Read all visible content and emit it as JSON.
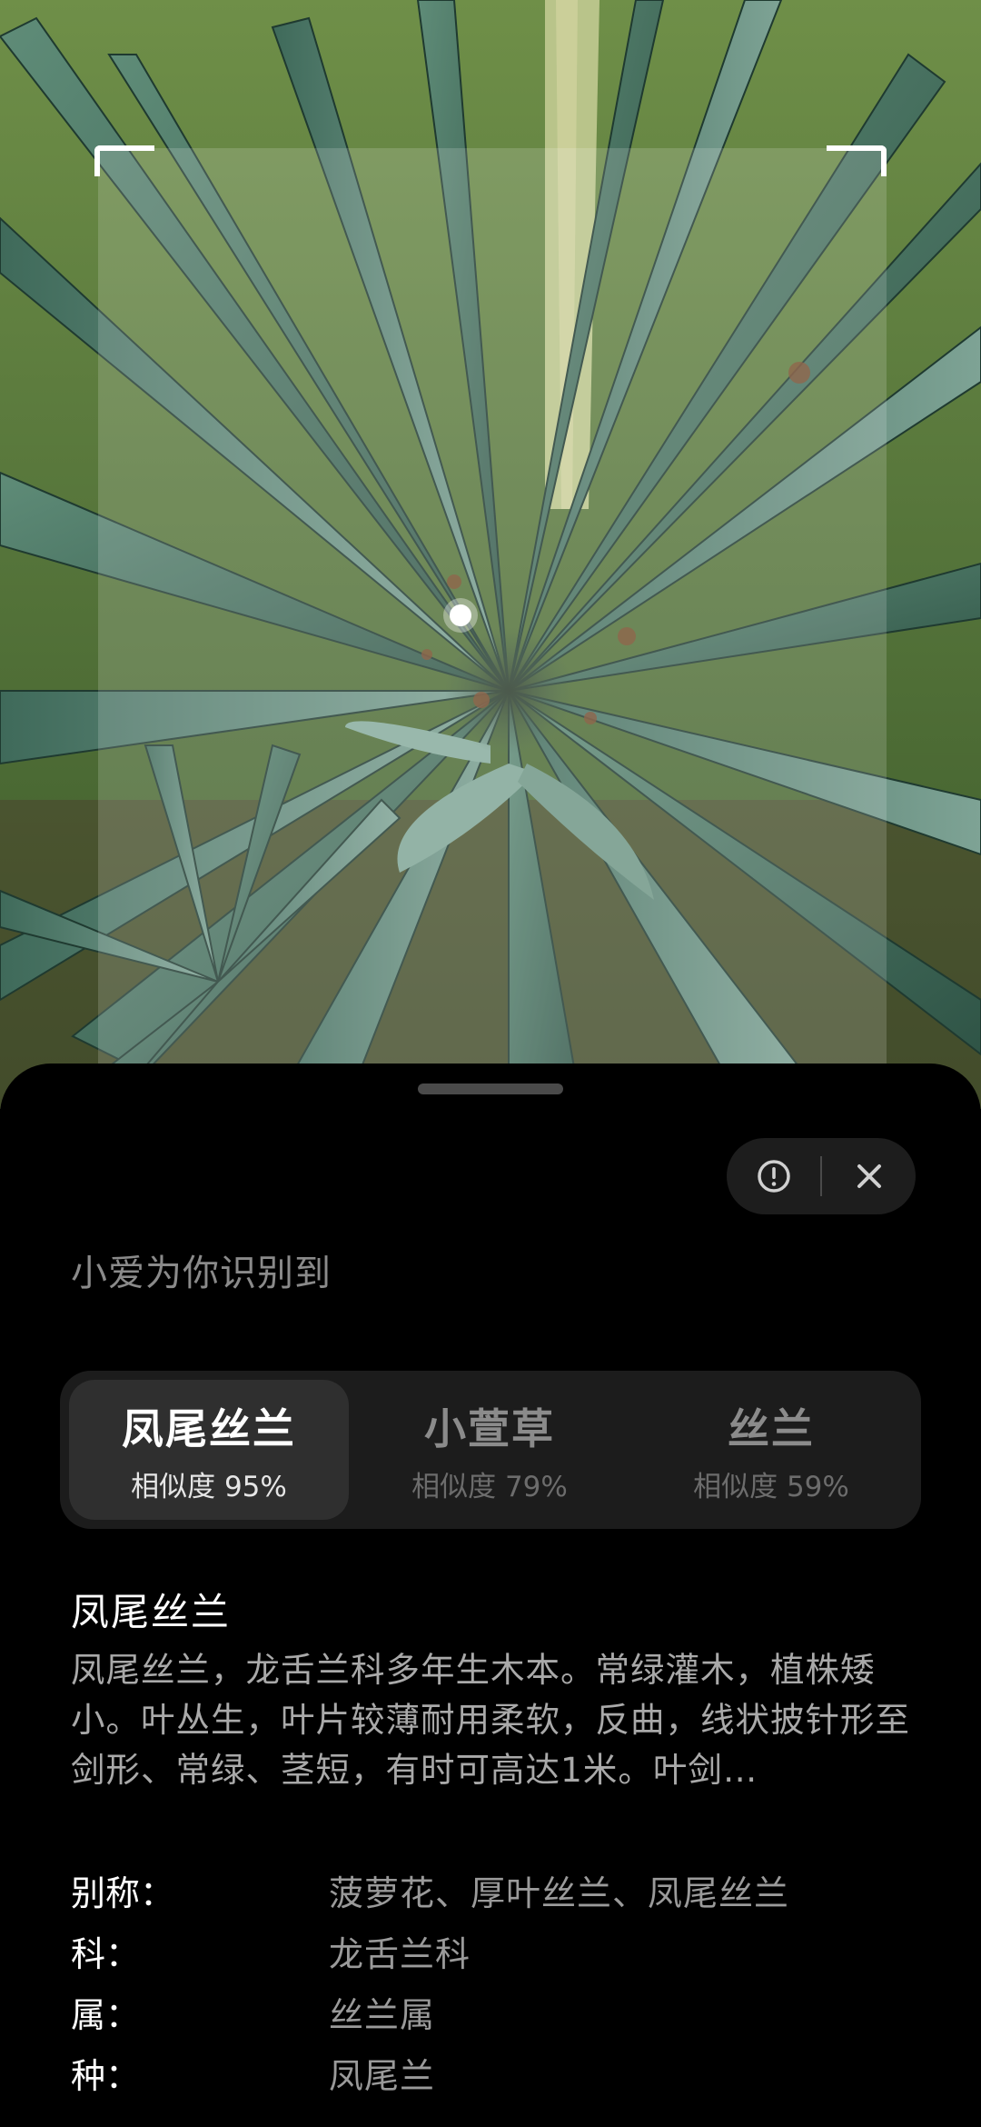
{
  "camera": {
    "subject": "plant-photo"
  },
  "sheet": {
    "heading": "小爱为你识别到",
    "candidates": [
      {
        "name": "凤尾丝兰",
        "score": "相似度 95%",
        "selected": true
      },
      {
        "name": "小萱草",
        "score": "相似度 79%",
        "selected": false
      },
      {
        "name": "丝兰",
        "score": "相似度 59%",
        "selected": false
      }
    ],
    "result": {
      "title": "凤尾丝兰",
      "description": "凤尾丝兰，龙舌兰科多年生木本。常绿灌木，植株矮小。叶丛生，叶片较薄耐用柔软，反曲，线状披针形至剑形、常绿、茎短，有时可高达1米。叶剑…",
      "properties": [
        {
          "key": "别称：",
          "value": "菠萝花、厚叶丝兰、凤尾丝兰"
        },
        {
          "key": "科：",
          "value": "龙舌兰科"
        },
        {
          "key": "属：",
          "value": "丝兰属"
        },
        {
          "key": "种：",
          "value": "凤尾兰"
        }
      ]
    },
    "actions": {
      "report_icon": "exclamation-circle-icon",
      "close_icon": "close-icon"
    }
  },
  "colors": {
    "sheet_bg": "#000000",
    "tab_bar_bg": "#1c1c1c",
    "tab_active_bg": "#2f2f2f"
  }
}
